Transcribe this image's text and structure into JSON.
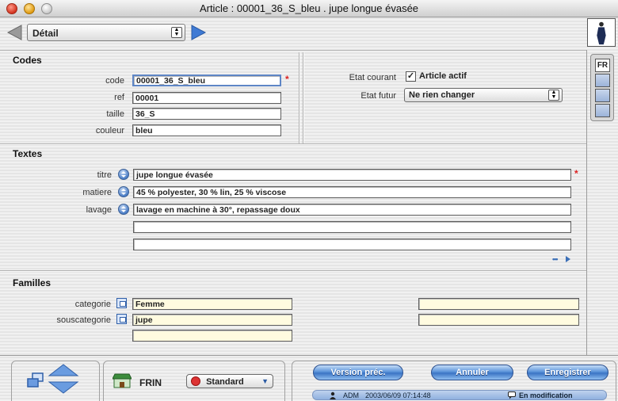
{
  "window": {
    "title": "Article : 00001_36_S_bleu . jupe longue évasée"
  },
  "toolbar": {
    "view_select": "Détail"
  },
  "codes": {
    "section_label": "Codes",
    "code_label": "code",
    "code_value": "00001_36_S_bleu",
    "ref_label": "ref",
    "ref_value": "00001",
    "taille_label": "taille",
    "taille_value": "36_S",
    "couleur_label": "couleur",
    "couleur_value": "bleu"
  },
  "etat": {
    "courant_label": "Etat courant",
    "courant_checkbox_label": "Article actif",
    "courant_checked": true,
    "futur_label": "Etat futur",
    "futur_value": "Ne rien changer"
  },
  "textes": {
    "section_label": "Textes",
    "titre_label": "titre",
    "titre_value": "jupe longue évasée",
    "matiere_label": "matiere",
    "matiere_value": "45 % polyester, 30 % lin, 25 % viscose",
    "lavage_label": "lavage",
    "lavage_value": "lavage en machine à 30°, repassage doux",
    "extra1_value": "",
    "extra2_value": "",
    "more_glyph": "•••"
  },
  "familles": {
    "section_label": "Familles",
    "categorie_label": "categorie",
    "categorie_value": "Femme",
    "souscategorie_label": "souscategorie",
    "souscategorie_value": "jupe",
    "extra_value": "",
    "right1_value": "",
    "right2_value": ""
  },
  "language": {
    "active": "FR"
  },
  "footer": {
    "store_name": "FRIN",
    "mode_select": "Standard",
    "btn_previous": "Version préc.",
    "btn_cancel": "Annuler",
    "btn_save": "Enregistrer",
    "status_user": "ADM",
    "status_timestamp": "2003/06/09  07:14:48",
    "status_mode": "En modification"
  },
  "colors": {
    "accent": "#4a7fd0",
    "required": "#dd2222",
    "field_yellow": "#fffbe0"
  }
}
